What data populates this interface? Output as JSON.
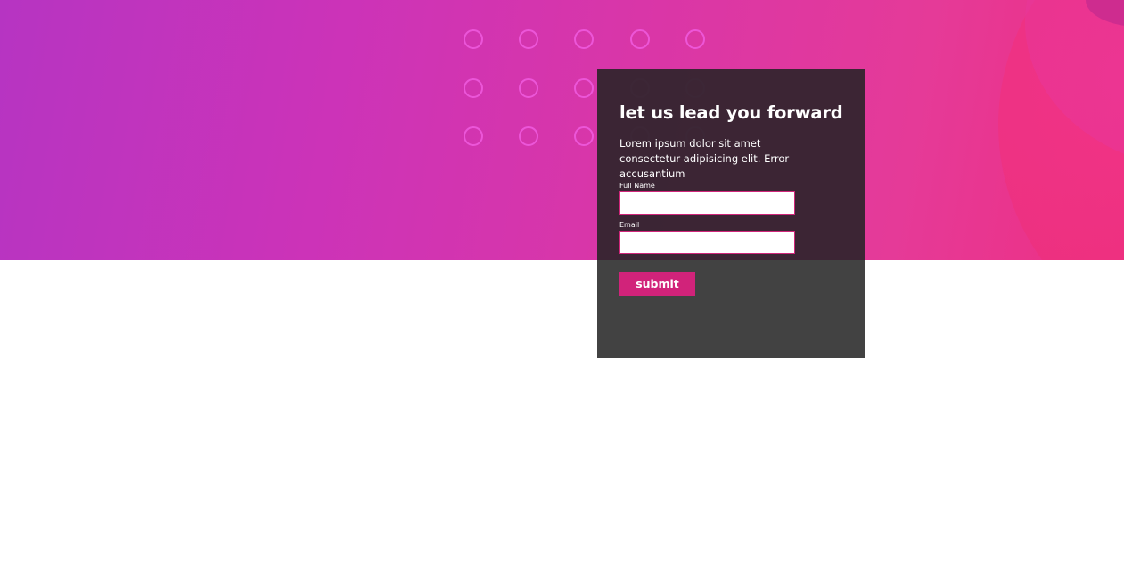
{
  "hero": {
    "gradient_start": "#b634c2",
    "gradient_end": "#ee2f82",
    "dot_color": "#f05ce0",
    "dot_rows": 3,
    "dot_cols": 5
  },
  "card": {
    "title": "let us lead you forward",
    "description": "Lorem ipsum dolor sit amet consectetur adipisicing elit. Error accusantium",
    "background": "#3c3c3c",
    "accent": "#d1237a"
  },
  "form": {
    "full_name": {
      "label": "Full Name",
      "value": "",
      "placeholder": ""
    },
    "email": {
      "label": "Email",
      "value": "",
      "placeholder": ""
    },
    "submit_label": "submit"
  }
}
